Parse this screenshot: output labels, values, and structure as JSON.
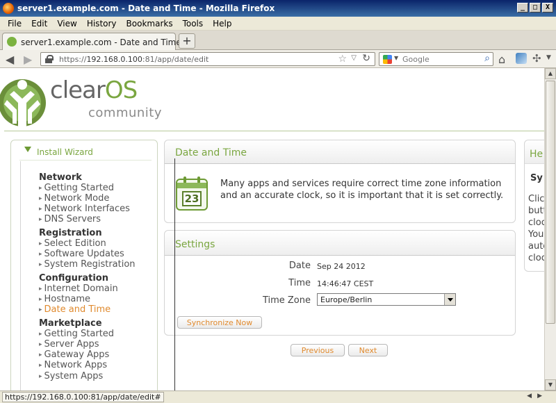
{
  "window": {
    "title": "server1.example.com - Date and Time - Mozilla Firefox",
    "buttons": [
      "_",
      "□",
      "X"
    ]
  },
  "menubar": [
    "File",
    "Edit",
    "View",
    "History",
    "Bookmarks",
    "Tools",
    "Help"
  ],
  "tab": {
    "title": "server1.example.com - Date and Time",
    "new_tab_label": "+"
  },
  "navbar": {
    "url_prefix": "https://",
    "url_host": "192.168.0.100",
    "url_rest": ":81/app/date/edit",
    "search_placeholder": "Google"
  },
  "logo": {
    "word_clear": "clear",
    "word_os": "OS",
    "sub": "community"
  },
  "sidebar": {
    "wizard_label": "Install Wizard",
    "sections": [
      {
        "title": "Network",
        "items": [
          "Getting Started",
          "Network Mode",
          "Network Interfaces",
          "DNS Servers"
        ]
      },
      {
        "title": "Registration",
        "items": [
          "Select Edition",
          "Software Updates",
          "System Registration"
        ]
      },
      {
        "title": "Configuration",
        "items": [
          "Internet Domain",
          "Hostname",
          "Date and Time"
        ]
      },
      {
        "title": "Marketplace",
        "items": [
          "Getting Started",
          "Server Apps",
          "Gateway Apps",
          "Network Apps",
          "System Apps"
        ]
      }
    ],
    "active_item": "Date and Time"
  },
  "date_panel": {
    "title": "Date and Time",
    "calendar_day": "23",
    "intro": "Many apps and services require correct time zone information and an accurate clock, so it is important that it is set correctly."
  },
  "settings_panel": {
    "title": "Settings",
    "date_label": "Date",
    "date_value": "Sep 24 2012",
    "time_label": "Time",
    "time_value": "14:46:47 CEST",
    "tz_label": "Time Zone",
    "tz_value": "Europe/Berlin",
    "sync_button": "Synchronize Now"
  },
  "wizard_nav": {
    "previous": "Previous",
    "next": "Next"
  },
  "help_panel": {
    "title": "He",
    "sub": "Sy",
    "lines": [
      "Clic",
      "butt",
      "cloc",
      "You",
      "auto",
      "cloc"
    ]
  },
  "status_url": "https://192.168.0.100:81/app/date/edit#",
  "colors": {
    "accent_green": "#7aa640",
    "link_orange": "#e08a2e"
  }
}
